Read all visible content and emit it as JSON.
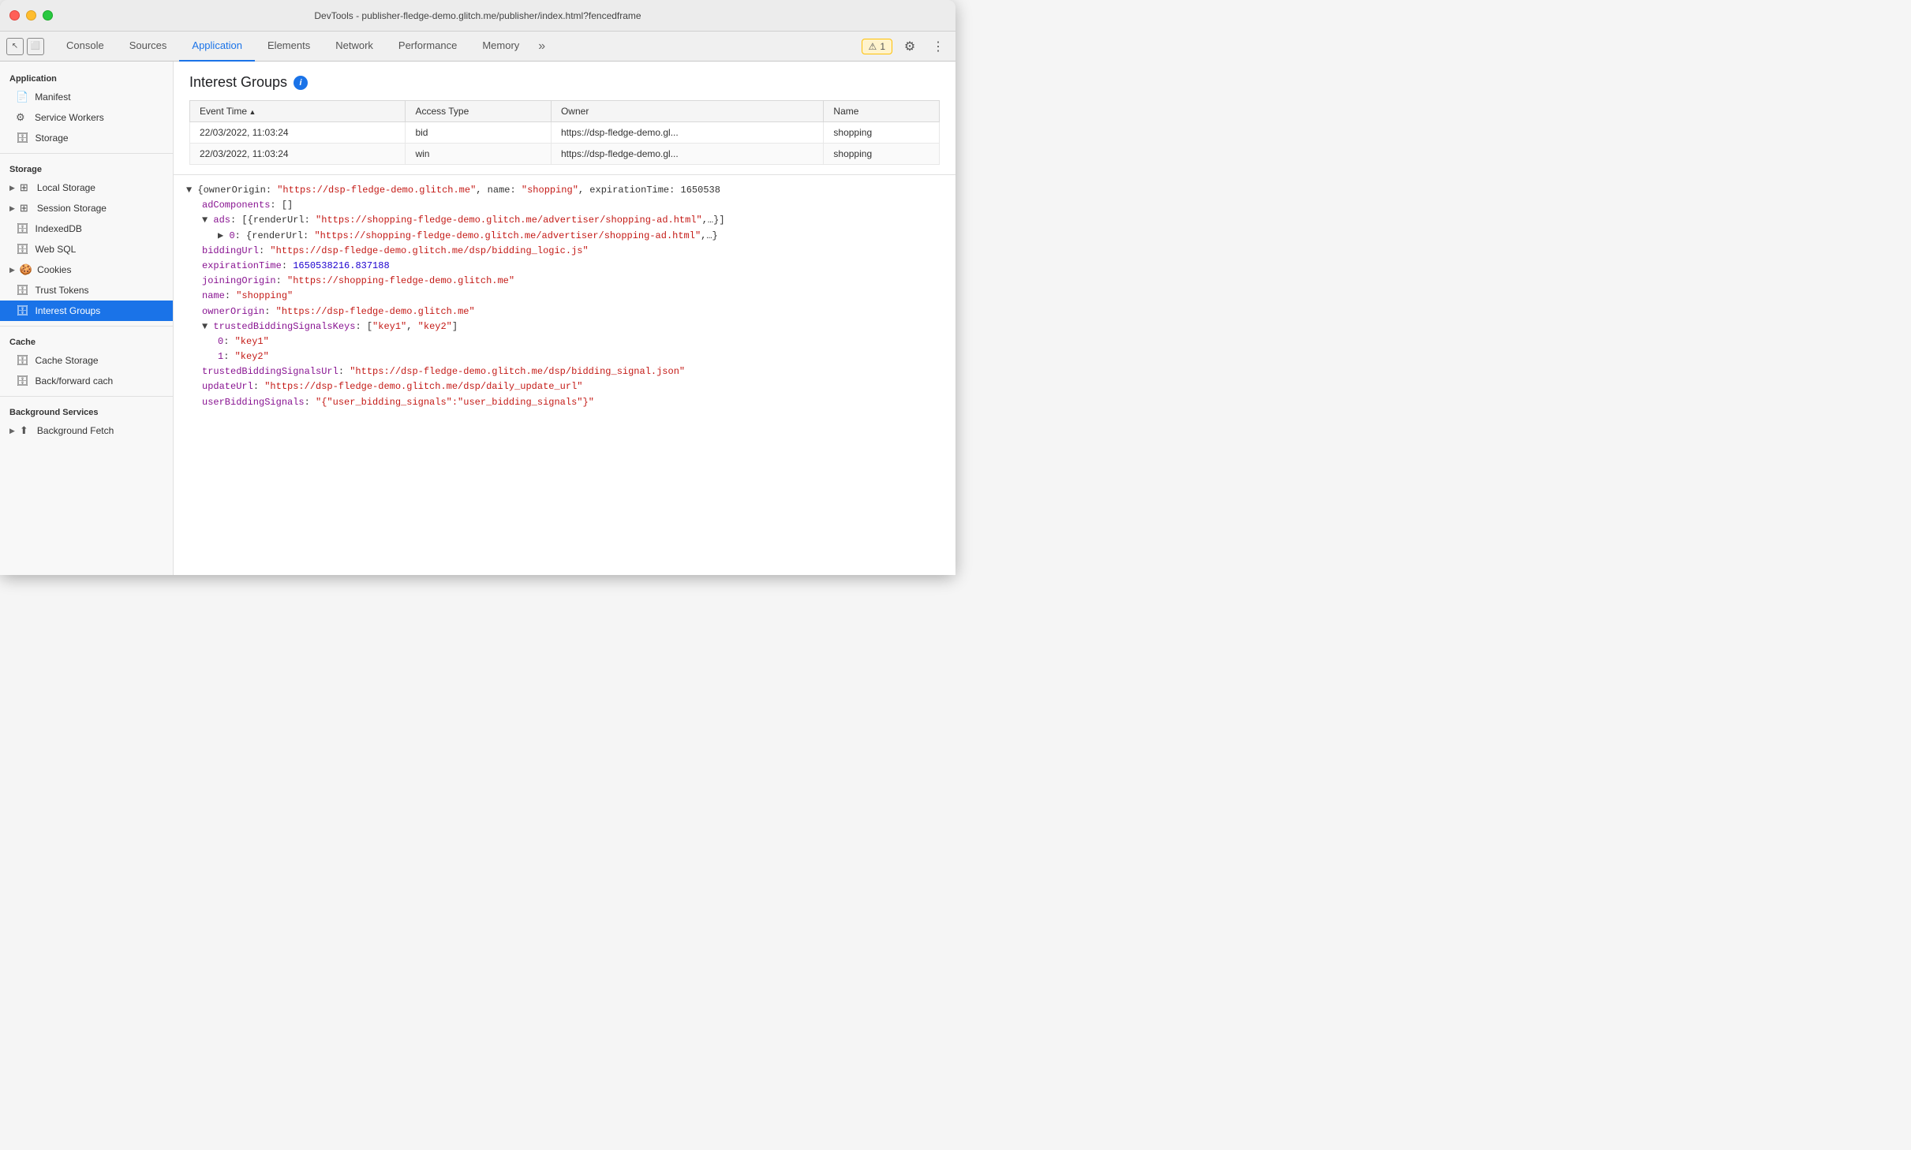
{
  "titleBar": {
    "title": "DevTools - publisher-fledge-demo.glitch.me/publisher/index.html?fencedframe"
  },
  "tabs": {
    "items": [
      {
        "label": "Console",
        "active": false
      },
      {
        "label": "Sources",
        "active": false
      },
      {
        "label": "Application",
        "active": true
      },
      {
        "label": "Elements",
        "active": false
      },
      {
        "label": "Network",
        "active": false
      },
      {
        "label": "Performance",
        "active": false
      },
      {
        "label": "Memory",
        "active": false
      }
    ],
    "more_label": "»",
    "warning_count": "1",
    "warning_icon": "⚠"
  },
  "sidebar": {
    "application_section": "Application",
    "items_application": [
      {
        "label": "Manifest",
        "icon": "📄"
      },
      {
        "label": "Service Workers",
        "icon": "⚙"
      },
      {
        "label": "Storage",
        "icon": "🗄"
      }
    ],
    "storage_section": "Storage",
    "items_storage": [
      {
        "label": "Local Storage",
        "icon": "▶ ⊞",
        "hasArrow": true
      },
      {
        "label": "Session Storage",
        "icon": "▶ ⊞",
        "hasArrow": true
      },
      {
        "label": "IndexedDB",
        "icon": "🗄"
      },
      {
        "label": "Web SQL",
        "icon": "🗄"
      },
      {
        "label": "Cookies",
        "icon": "▶ 🍪",
        "hasArrow": true
      },
      {
        "label": "Trust Tokens",
        "icon": "🗄"
      },
      {
        "label": "Interest Groups",
        "icon": "🗄",
        "active": true
      }
    ],
    "cache_section": "Cache",
    "items_cache": [
      {
        "label": "Cache Storage",
        "icon": "🗄"
      },
      {
        "label": "Back/forward cach",
        "icon": "🗄"
      }
    ],
    "background_section": "Background Services",
    "items_background": [
      {
        "label": "Background Fetch",
        "icon": "▶ ⬆",
        "hasArrow": true
      }
    ]
  },
  "panel": {
    "title": "Interest Groups",
    "info_icon": "i",
    "table": {
      "columns": [
        "Event Time",
        "Access Type",
        "Owner",
        "Name"
      ],
      "rows": [
        {
          "eventTime": "22/03/2022, 11:03:24",
          "accessType": "bid",
          "owner": "https://dsp-fledge-demo.gl...",
          "name": "shopping"
        },
        {
          "eventTime": "22/03/2022, 11:03:24",
          "accessType": "win",
          "owner": "https://dsp-fledge-demo.gl...",
          "name": "shopping"
        }
      ]
    }
  },
  "jsonPanel": {
    "lines": [
      {
        "text": "{ownerOrigin: \"https://dsp-fledge-demo.glitch.me\", name: \"shopping\", expirationTime: 1650538",
        "type": "plain",
        "indent": 0,
        "expandable": true,
        "expanded": true
      },
      {
        "key": "adComponents",
        "value": "[]",
        "type": "keyval",
        "indent": 1
      },
      {
        "key": "ads",
        "value": "[{renderUrl: \"https://shopping-fledge-demo.glitch.me/advertiser/shopping-ad.html\",…}]",
        "type": "key-expandable",
        "indent": 1,
        "expanded": true
      },
      {
        "key": "0",
        "value": "{renderUrl: \"https://shopping-fledge-demo.glitch.me/advertiser/shopping-ad.html\",…}",
        "type": "key-expandable",
        "indent": 2,
        "expandable": true
      },
      {
        "key": "biddingUrl",
        "value": "\"https://dsp-fledge-demo.glitch.me/dsp/bidding_logic.js\"",
        "type": "keystring",
        "indent": 1
      },
      {
        "key": "expirationTime",
        "value": "1650538216.837188",
        "type": "keynumber",
        "indent": 1
      },
      {
        "key": "joiningOrigin",
        "value": "\"https://shopping-fledge-demo.glitch.me\"",
        "type": "keystring",
        "indent": 1
      },
      {
        "key": "name",
        "value": "\"shopping\"",
        "type": "keystring",
        "indent": 1
      },
      {
        "key": "ownerOrigin",
        "value": "\"https://dsp-fledge-demo.glitch.me\"",
        "type": "keystring",
        "indent": 1
      },
      {
        "key": "trustedBiddingSignalsKeys",
        "value": "[\"key1\", \"key2\"]",
        "type": "key-expandable",
        "indent": 1,
        "expanded": true
      },
      {
        "key": "0",
        "value": "\"key1\"",
        "type": "keystring",
        "indent": 2
      },
      {
        "key": "1",
        "value": "\"key2\"",
        "type": "keystring",
        "indent": 2
      },
      {
        "key": "trustedBiddingSignalsUrl",
        "value": "\"https://dsp-fledge-demo.glitch.me/dsp/bidding_signal.json\"",
        "type": "keystring",
        "indent": 1
      },
      {
        "key": "updateUrl",
        "value": "\"https://dsp-fledge-demo.glitch.me/dsp/daily_update_url\"",
        "type": "keystring",
        "indent": 1
      },
      {
        "key": "userBiddingSignals",
        "value": "\"{\\\"user_bidding_signals\\\":\\\"user_bidding_signals\\\"}\"",
        "type": "keystring",
        "indent": 1
      }
    ]
  }
}
